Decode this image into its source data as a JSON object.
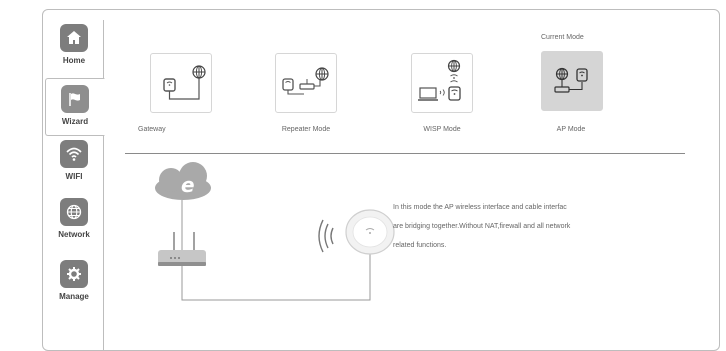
{
  "nav": {
    "items": [
      {
        "label": "Home",
        "icon": "home-icon"
      },
      {
        "label": "Wizard",
        "icon": "flag-icon"
      },
      {
        "label": "WIFI",
        "icon": "wifi-icon"
      },
      {
        "label": "Network",
        "icon": "globe-icon"
      },
      {
        "label": "Manage",
        "icon": "gear-icon"
      }
    ],
    "active": "Wizard"
  },
  "modes": {
    "current_tag": "Current Mode",
    "items": [
      {
        "label": "Gateway"
      },
      {
        "label": "Repeater Mode"
      },
      {
        "label": "WISP Mode"
      },
      {
        "label": "AP Mode"
      }
    ],
    "current": "AP Mode"
  },
  "description": {
    "lines": [
      "In this mode the AP wireless interface and cable interfac",
      "are bridging together.Without NAT,firewall and all network",
      "related functions."
    ]
  },
  "colors": {
    "tile": "#7d7d7d",
    "current_card": "#d5d5d5",
    "cloud": "#a9a9a9",
    "line": "#9a9a9a"
  }
}
